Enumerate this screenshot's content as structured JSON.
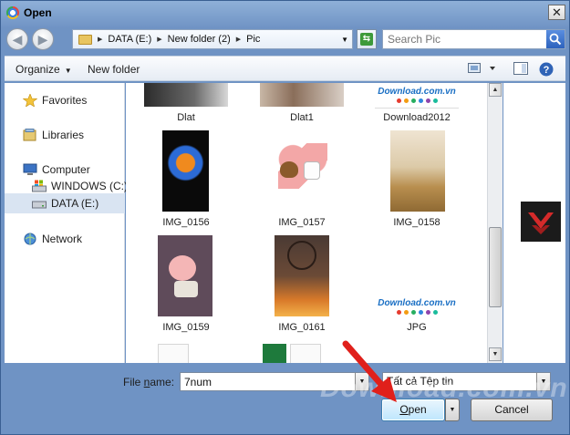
{
  "window": {
    "title": "Open",
    "close_glyph": "✕"
  },
  "navigation": {
    "back_glyph": "◀",
    "forward_glyph": "▶",
    "breadcrumb": [
      "DATA (E:)",
      "New folder (2)",
      "Pic"
    ],
    "search_placeholder": "Search Pic"
  },
  "toolbar": {
    "organize_label": "Organize",
    "new_folder_label": "New folder"
  },
  "nav_pane": {
    "items": [
      {
        "label": "Favorites",
        "icon": "star-icon"
      },
      {
        "label": "Libraries",
        "icon": "libraries-icon"
      },
      {
        "label": "Computer",
        "icon": "computer-icon"
      },
      {
        "label": "WINDOWS (C:)",
        "icon": "windows-drive-icon"
      },
      {
        "label": "DATA (E:)",
        "icon": "drive-icon",
        "selected": true
      },
      {
        "label": "Network",
        "icon": "network-icon"
      }
    ]
  },
  "files": [
    {
      "name": "Dlat"
    },
    {
      "name": "Dlat1"
    },
    {
      "name": "Download2012"
    },
    {
      "name": "IMG_0156"
    },
    {
      "name": "IMG_0157"
    },
    {
      "name": "IMG_0158"
    },
    {
      "name": "IMG_0159"
    },
    {
      "name": "IMG_0161"
    },
    {
      "name": "JPG"
    }
  ],
  "download_logo_text": "Download.com.vn",
  "bottom": {
    "file_name_label_pre": "File ",
    "file_name_label_key": "n",
    "file_name_label_post": "ame:",
    "file_name_value": "7num",
    "file_type_value": "Tất cả Tệp tin",
    "open_label_key": "O",
    "open_label_rest": "pen",
    "cancel_label": "Cancel"
  },
  "watermark_text": "Download.com.vn",
  "colors": {
    "accent": "#3c7fb1",
    "selection": "#d9e4f2",
    "arrow": "#e0201b"
  }
}
